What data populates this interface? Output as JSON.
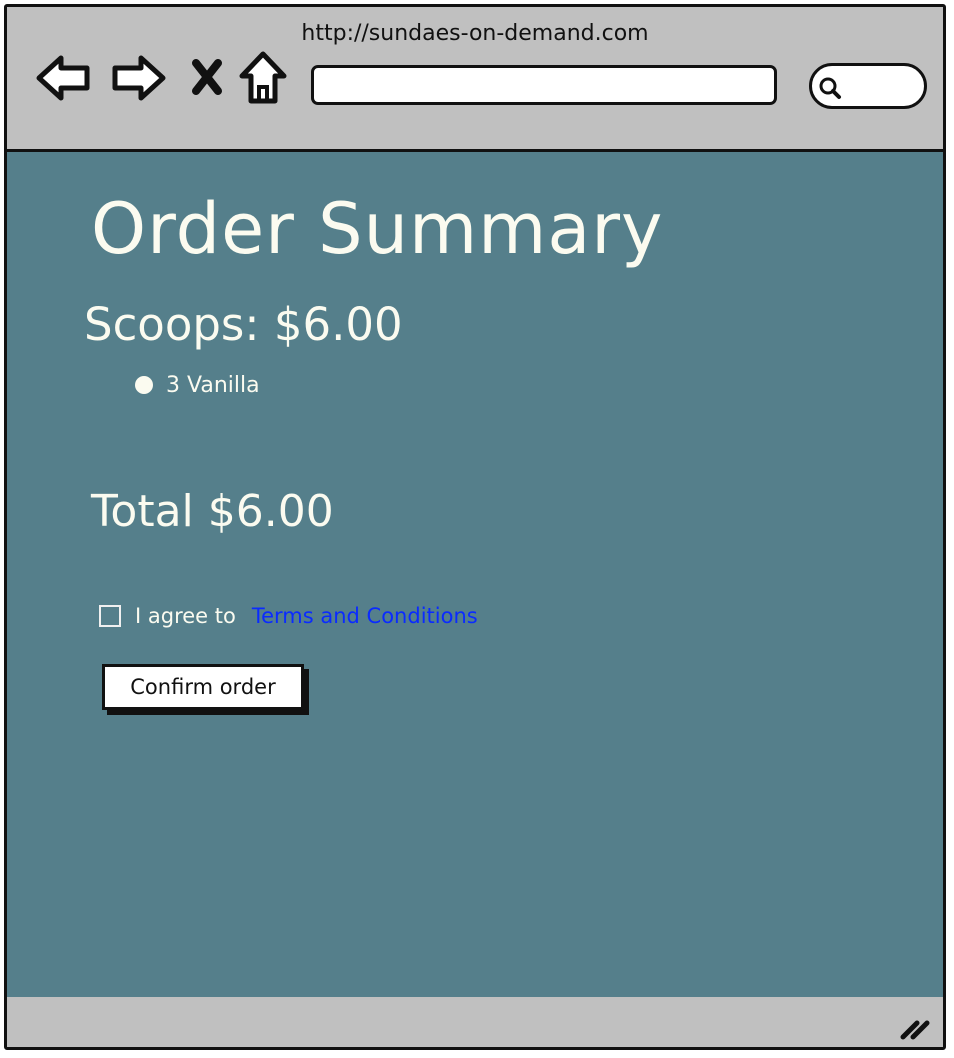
{
  "browser": {
    "url": "http://sundaes-on-demand.com",
    "icons": [
      "back-icon",
      "forward-icon",
      "stop-icon",
      "home-icon",
      "search-icon",
      "resize-grip-icon"
    ]
  },
  "page": {
    "title": "Order Summary",
    "scoops_heading": "Scoops: $6.00",
    "scoops": [
      {
        "label": "3 Vanilla"
      }
    ],
    "total": "Total $6.00",
    "agree_text": "I agree to",
    "terms_link": "Terms and Conditions",
    "confirm_button": "Confirm order"
  },
  "colors": {
    "content_bg": "#557f8b",
    "chrome_bg": "#c0c0c0",
    "text_light": "#fbfbf0",
    "link": "#0a2bff"
  }
}
